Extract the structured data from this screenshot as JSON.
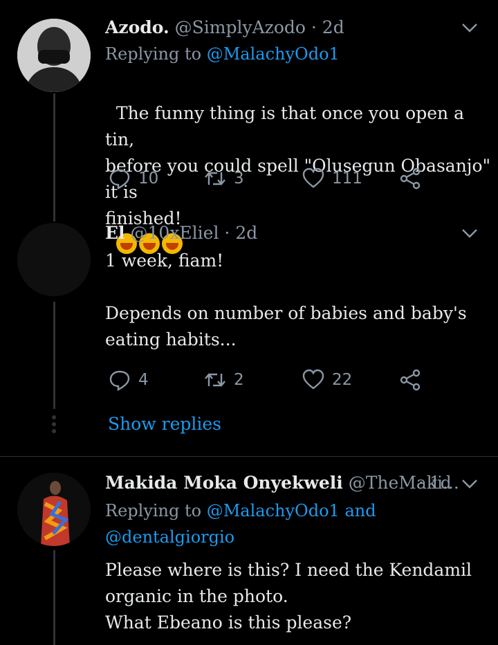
{
  "tweets": [
    {
      "name": "Azodo.",
      "handle": "@SimplyAzodo",
      "time": "· 2d",
      "replying_label": "Replying to",
      "replying_to": "@MalachyOdo1",
      "body": "The funny thing is that once you open a tin,\nbefore you could spell \"Olusegun Obasanjo\" it is\nfinished!",
      "emoji": [
        "crying-face",
        "crying-face",
        "crying-face"
      ],
      "replies": "10",
      "retweets": "3",
      "likes": "111"
    },
    {
      "name": "El",
      "handle": "@10xEliel",
      "time": "· 2d",
      "body": "1 week, fiam!\n\nDepends on number of babies and baby's\neating habits...",
      "replies": "4",
      "retweets": "2",
      "likes": "22",
      "show_replies": "Show replies"
    },
    {
      "name": "Makida Moka Onyekweli",
      "handle": "@TheMaki...",
      "time": "· 1d",
      "replying_label": "Replying to",
      "replying_to": "@MalachyOdo1 and",
      "replying_to_2": "@dentalgiorgio",
      "body": "Please where is this? I need the Kendamil\norganic in the photo.\nWhat Ebeano is this please?"
    }
  ],
  "colors": {
    "accent": "#1d9bf0",
    "muted": "#8b98a5",
    "text": "#e7e9ea",
    "background": "#000000"
  }
}
